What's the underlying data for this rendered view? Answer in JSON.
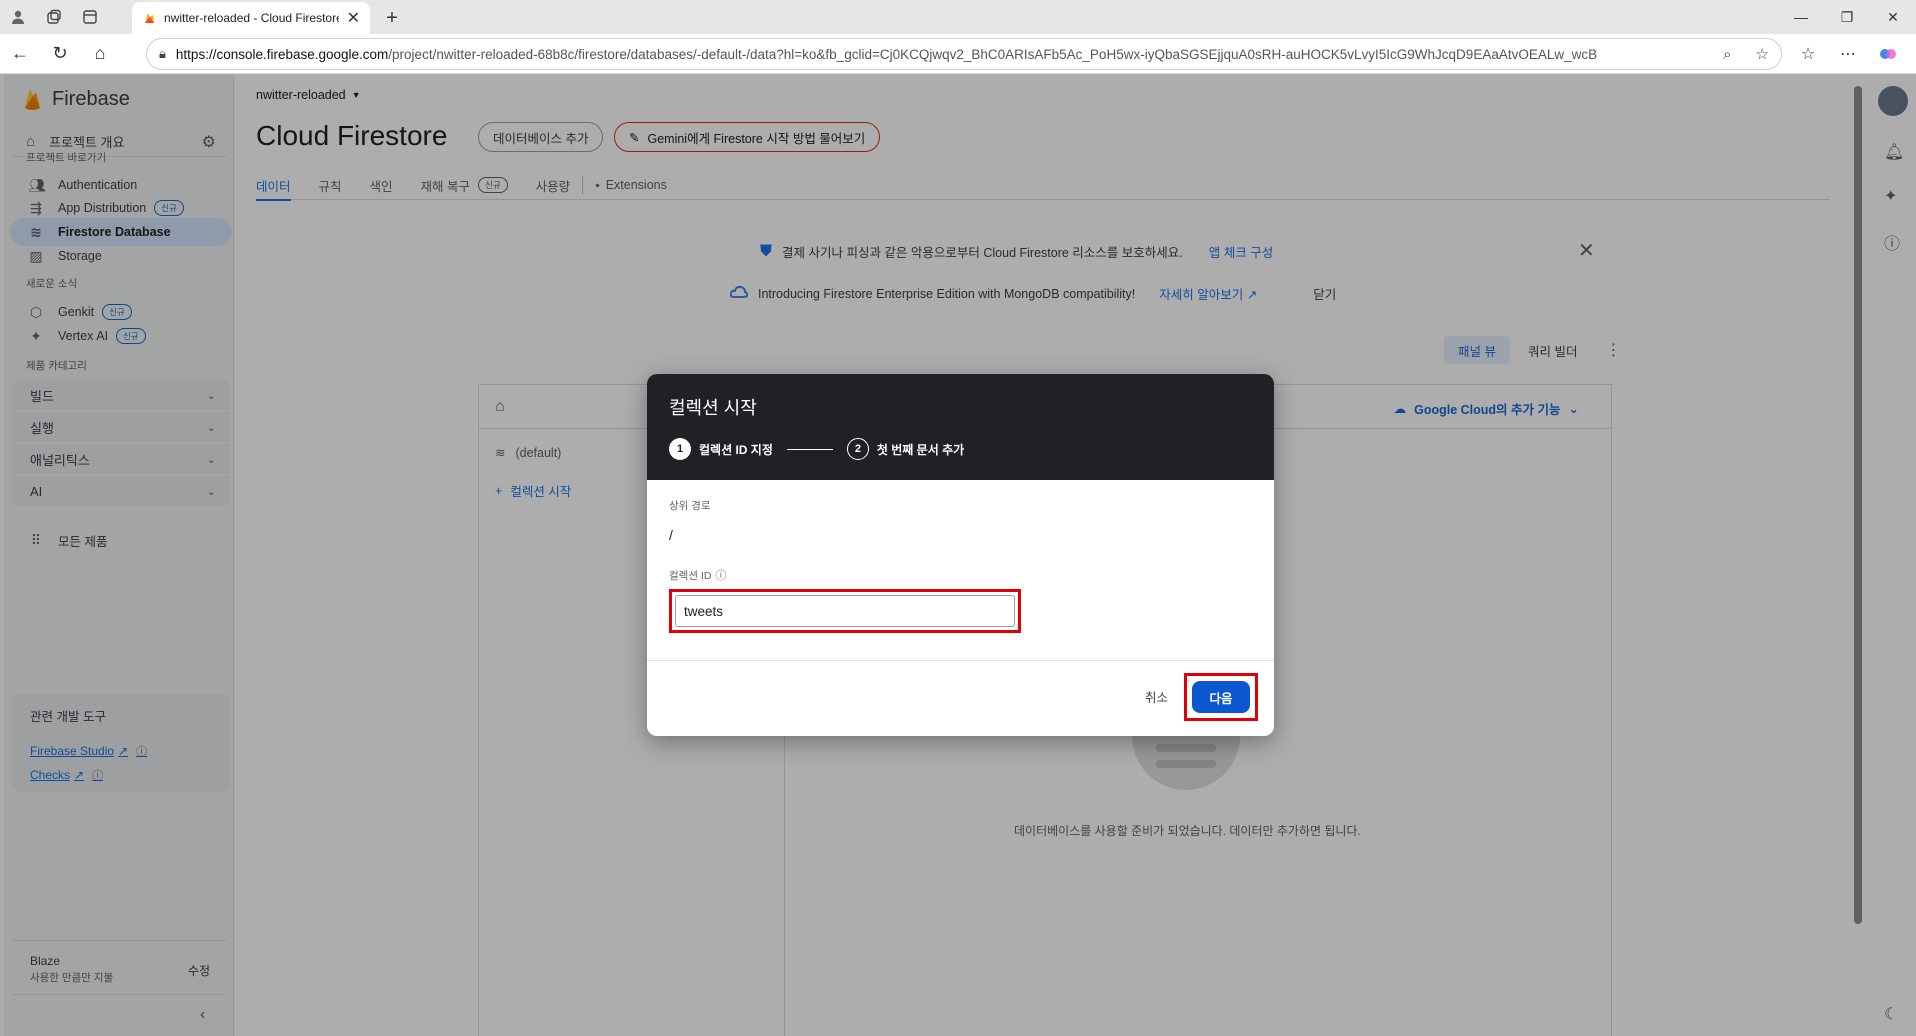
{
  "browser": {
    "tab_title": "nwitter-reloaded - Cloud Firestore",
    "url_host": "https://console.firebase.google.com",
    "url_path": "/project/nwitter-reloaded-68b8c/firestore/databases/-default-/data?hl=ko&fb_gclid=Cj0KCQjwqv2_BhC0ARIsAFb5Ac_PoH5wx-iyQbaSGSEjjquA0sRH-auHOCK5vLvyI5IcG9WhJcqD9EAaAtvOEALw_wcB"
  },
  "sidebar": {
    "brand": "Firebase",
    "project_overview": "프로젝트 개요",
    "shortcuts_label": "프로젝트 바로가기",
    "items": [
      {
        "label": "Authentication",
        "badge": ""
      },
      {
        "label": "App Distribution",
        "badge": "신규"
      },
      {
        "label": "Firestore Database",
        "badge": ""
      },
      {
        "label": "Storage",
        "badge": ""
      }
    ],
    "news_label": "새로운 소식",
    "news_items": [
      {
        "label": "Genkit",
        "badge": "신규"
      },
      {
        "label": "Vertex AI",
        "badge": "신규"
      }
    ],
    "category_label": "제품 카테고리",
    "categories": [
      "빌드",
      "실행",
      "애널리틱스",
      "AI"
    ],
    "all_products": "모든 제품",
    "devtools": {
      "heading": "관련 개발 도구",
      "links": [
        "Firebase Studio",
        "Checks"
      ]
    },
    "plan": {
      "name": "Blaze",
      "desc": "사용한 만큼만 지불",
      "edit": "수정"
    }
  },
  "main": {
    "project_selector": "nwitter-reloaded",
    "title": "Cloud Firestore",
    "add_db_button": "데이터베이스 추가",
    "gemini_button": "Gemini에게 Firestore 시작 방법 물어보기",
    "tabs": [
      "데이터",
      "규칙",
      "색인",
      "재해 복구",
      "사용량",
      "Extensions"
    ],
    "tab_badge": "신규",
    "notice1": {
      "text": "결제 사기나 피싱과 같은 악용으로부터 Cloud Firestore 리소스를 보호하세요.",
      "link": "앱 체크 구성"
    },
    "notice2": {
      "text": "Introducing Firestore Enterprise Edition with MongoDB compatibility!",
      "link": "자세히 알아보기",
      "close": "닫기"
    },
    "view_panel": "패널 뷰",
    "view_query": "쿼리 빌더",
    "gcloud_link": "Google Cloud의 추가 기능",
    "db_name": "(default)",
    "start_collection": "컬렉션 시작",
    "empty_text": "데이터베이스를 사용할 준비가 되었습니다. 데이터만 추가하면 됩니다."
  },
  "dialog": {
    "title": "컬렉션 시작",
    "steps": [
      {
        "num": "1",
        "label": "컬렉션 ID 지정"
      },
      {
        "num": "2",
        "label": "첫 번째 문서 추가"
      }
    ],
    "parent_path_label": "상위 경로",
    "parent_path_value": "/",
    "collection_id_label": "컬렉션 ID",
    "collection_id_value": "tweets",
    "cancel": "취소",
    "next": "다음"
  },
  "colors": {
    "accent": "#1a73e8",
    "primary_button": "#0b57d0",
    "highlight": "#e0000a",
    "dialog_header": "#202124"
  }
}
